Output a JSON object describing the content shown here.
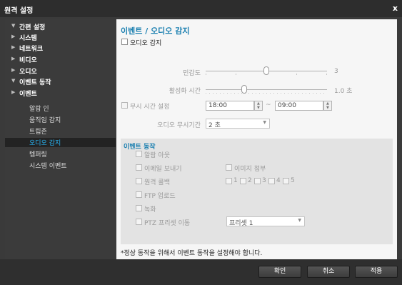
{
  "window": {
    "title": "원격 설정",
    "close": "x"
  },
  "sidebar": {
    "nav": [
      {
        "label": "간편 설정",
        "arrow": "▼"
      },
      {
        "label": "시스템",
        "arrow": "▶"
      },
      {
        "label": "네트워크",
        "arrow": "▶"
      },
      {
        "label": "비디오",
        "arrow": "▶"
      },
      {
        "label": "오디오",
        "arrow": "▶"
      },
      {
        "label": "이벤트 동작",
        "arrow": "▼"
      },
      {
        "label": "이벤트",
        "arrow": "▶"
      }
    ],
    "sub": [
      {
        "label": "알람 인"
      },
      {
        "label": "움직임 감지"
      },
      {
        "label": "트립존"
      },
      {
        "label": "오디오 감지"
      },
      {
        "label": "템퍼링"
      },
      {
        "label": "시스템 이벤트"
      }
    ]
  },
  "panel": {
    "title": "이벤트 / 오디오 감지",
    "audio_detect": "오디오 감지",
    "sensitivity": {
      "label": "민감도",
      "value": "3",
      "level": 3,
      "max": 5
    },
    "activation": {
      "label": "활성화 시간",
      "value": "1.0 초",
      "level_fraction": 0.3
    },
    "ignore_time": {
      "label": "무시 시간 설정",
      "from": "18:00",
      "to": "09:00",
      "sep": "~"
    },
    "audio_ignore": {
      "label": "오디오 무시기간",
      "value": "2 초"
    },
    "event_action": {
      "title": "이벤트 동작",
      "alarm_out": "알람 아웃",
      "send_email": "이메일 보내기",
      "attach_image": "이미지 첨부",
      "remote_callback": "원격 콜백",
      "callback_nums": [
        "1",
        "2",
        "3",
        "4",
        "5"
      ],
      "ftp_upload": "FTP 업로드",
      "record": "녹화",
      "ptz_preset": "PTZ 프리셋 이동",
      "preset_value": "프리셋 1"
    },
    "note": "*정상 동작을 위해서 이벤트 동작을 설정해야 합니다."
  },
  "footer": {
    "ok": "확인",
    "cancel": "취소",
    "apply": "적용"
  },
  "colors": {
    "accent": "#1a7fb0",
    "selected_text": "#29b6f6",
    "sidebar_bg": "#3b3b3b",
    "titlebar_bg": "#2d2d2d"
  }
}
